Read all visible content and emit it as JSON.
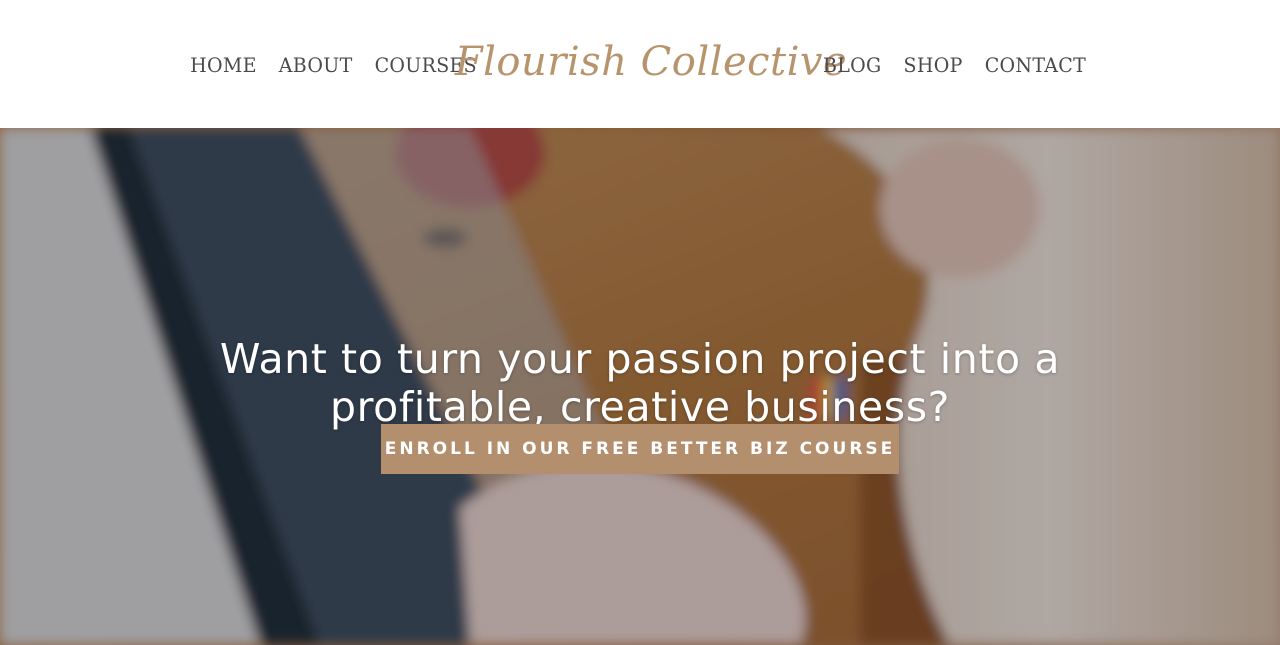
{
  "nav": {
    "left": [
      {
        "label": "HOME"
      },
      {
        "label": "ABOUT"
      },
      {
        "label": "COURSES"
      }
    ],
    "right": [
      {
        "label": "BLOG"
      },
      {
        "label": "SHOP"
      },
      {
        "label": "CONTACT"
      }
    ]
  },
  "logo": {
    "text": "Flourish Collective"
  },
  "hero": {
    "headline": "Want to turn your passion project into a profitable, creative business?",
    "cta_label": "ENROLL IN OUR FREE BETTER BIZ COURSE"
  },
  "colors": {
    "brand_accent": "#b8946d",
    "cta_background": "#b38f6e",
    "nav_text": "#4a4a4a",
    "hero_text": "#ffffff"
  }
}
